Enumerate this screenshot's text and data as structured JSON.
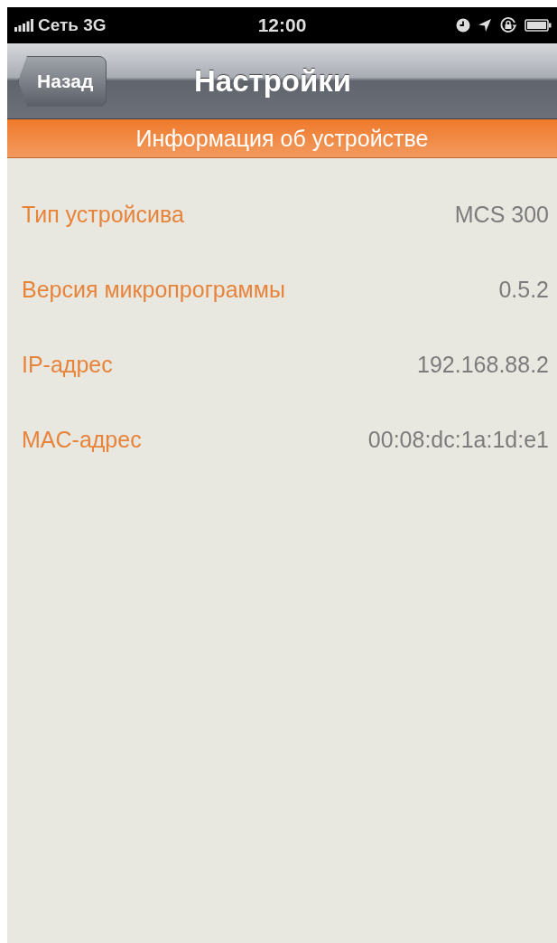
{
  "status_bar": {
    "carrier": "Сеть 3G",
    "time": "12:00"
  },
  "nav_bar": {
    "back_button": "Назад",
    "title": "Настройки"
  },
  "section_header": "Информация об устройстве",
  "rows": [
    {
      "label": "Тип устройсива",
      "value": "MCS 300"
    },
    {
      "label": "Версия микропрограммы",
      "value": "0.5.2"
    },
    {
      "label": "IP-адрес",
      "value": "192.168.88.2"
    },
    {
      "label": "MAC-адрес",
      "value": "00:08:dc:1a:1d:e1"
    }
  ]
}
